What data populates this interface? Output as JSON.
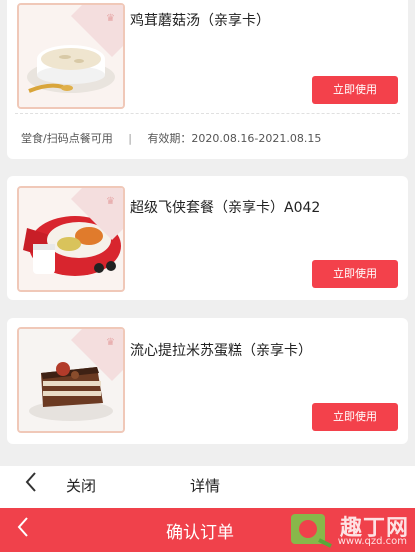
{
  "coupons": [
    {
      "title": "鸡茸蘑菇汤（亲享卡）",
      "button": "立即使用",
      "meta_usage": "堂食/扫码点餐可用",
      "meta_separator": "|",
      "meta_validity": "有效期：2020.08.16-2021.08.15"
    },
    {
      "title": "超级飞侠套餐（亲享卡）A042",
      "button": "立即使用"
    },
    {
      "title": "流心提拉米苏蛋糕（亲享卡）",
      "button": "立即使用"
    }
  ],
  "bottom_bar": {
    "back_icon": "chevron-left-icon",
    "close_label": "关闭",
    "detail_label": "详情"
  },
  "header": {
    "back_icon": "chevron-left-icon",
    "title": "确认订单"
  },
  "watermark": {
    "text": "趣丁网",
    "url": "www.qzd.com"
  },
  "colors": {
    "accent": "#f0414b",
    "background": "#efefef"
  }
}
